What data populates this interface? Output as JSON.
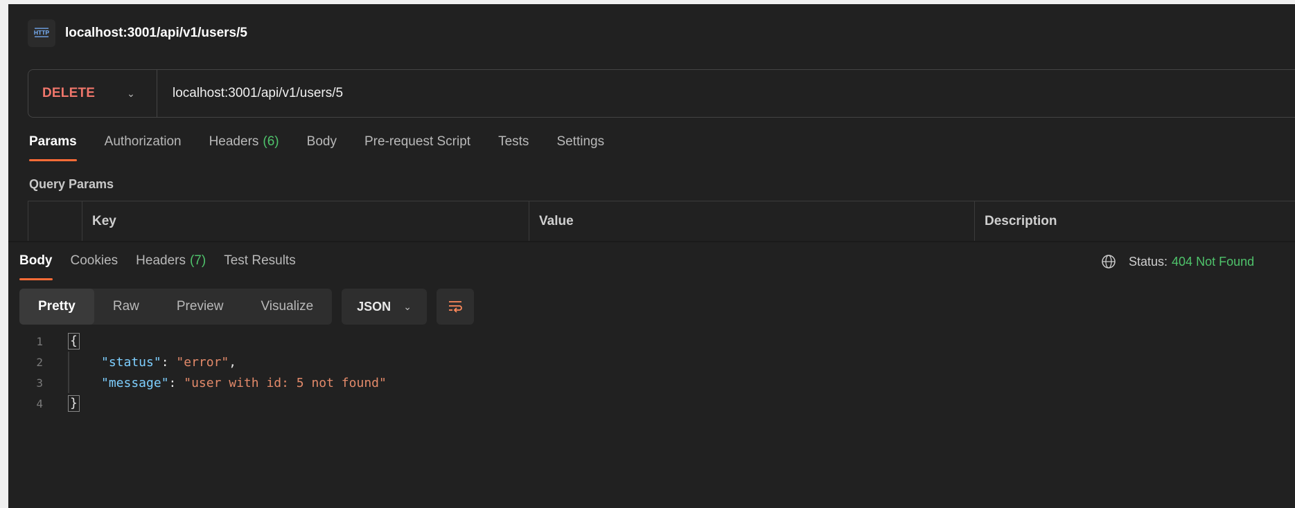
{
  "request": {
    "title": "localhost:3001/api/v1/users/5",
    "http_badge": "HTTP",
    "method": "DELETE",
    "url": "localhost:3001/api/v1/users/5",
    "tabs": [
      {
        "label": "Params",
        "active": true
      },
      {
        "label": "Authorization"
      },
      {
        "label": "Headers",
        "count": "(6)"
      },
      {
        "label": "Body"
      },
      {
        "label": "Pre-request Script"
      },
      {
        "label": "Tests"
      },
      {
        "label": "Settings"
      }
    ],
    "query_params_label": "Query Params",
    "table_headers": {
      "key": "Key",
      "value": "Value",
      "description": "Description"
    }
  },
  "response": {
    "tabs": [
      {
        "label": "Body",
        "active": true
      },
      {
        "label": "Cookies"
      },
      {
        "label": "Headers",
        "count": "(7)"
      },
      {
        "label": "Test Results"
      }
    ],
    "status_label": "Status:",
    "status_value": "404 Not Found",
    "view_modes": [
      "Pretty",
      "Raw",
      "Preview",
      "Visualize"
    ],
    "active_view": "Pretty",
    "format": "JSON",
    "code_lines": [
      {
        "n": "1",
        "open": "{"
      },
      {
        "n": "2",
        "key": "\"status\"",
        "sep": ": ",
        "val": "\"error\"",
        "trail": ","
      },
      {
        "n": "3",
        "key": "\"message\"",
        "sep": ": ",
        "val": "\"user with id: 5 not found\"",
        "trail": ""
      },
      {
        "n": "4",
        "close": "}"
      }
    ]
  },
  "colors": {
    "accent": "#ff6c37",
    "method_delete": "#f0766b",
    "success_count": "#4fc36b",
    "status_error": "#4fc36b",
    "json_key": "#7ecfff",
    "json_string": "#e38a6a"
  },
  "icons": {
    "http": "http-icon",
    "chevron": "chevron-down-icon",
    "globe": "globe-icon",
    "wrap": "wrap-lines-icon"
  }
}
